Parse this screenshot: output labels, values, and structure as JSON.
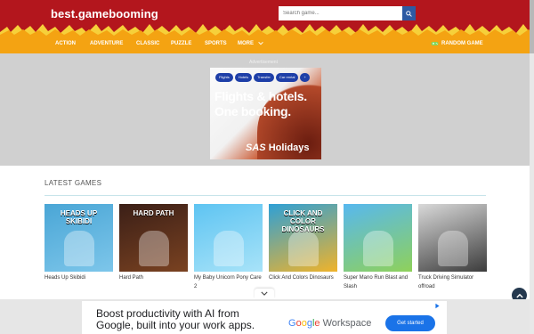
{
  "header": {
    "logo": "best.gamebooming",
    "search_placeholder": "Search game...",
    "search_icon": "magnifier"
  },
  "nav": {
    "items": [
      "ACTION",
      "ADVENTURE",
      "CLASSIC",
      "PUZZLE",
      "SPORTS",
      "MORE"
    ],
    "random": "RANDOM GAME",
    "random_icon": "gamepad"
  },
  "top_ad": {
    "label": "Advertisement",
    "tabs": [
      "Flights",
      "Hotels",
      "Transfer",
      "Car rental",
      "+"
    ],
    "headline": "Flights & hotels. One booking.",
    "brand_mark": "SAS",
    "brand_word": "Holidays"
  },
  "latest": {
    "title": "LATEST GAMES",
    "games": [
      {
        "title": "Heads Up Skibidi",
        "thumb_text": "HEADS UP SKIBIDI",
        "colors": [
          "#4aa6d6",
          "#7dc6ea"
        ]
      },
      {
        "title": "Hard Path",
        "thumb_text": "HARD PATH",
        "colors": [
          "#3b1f17",
          "#7a4221"
        ]
      },
      {
        "title": "My Baby Unicorn Pony Care 2",
        "thumb_text": "",
        "colors": [
          "#5ec4f2",
          "#a8e3f8"
        ]
      },
      {
        "title": "Click And Colors Dinosaurs",
        "thumb_text": "CLICK AND COLOR DINOSAURS",
        "colors": [
          "#2ea0d6",
          "#f0b32a"
        ]
      },
      {
        "title": "Super Mano Run Blast and Slash",
        "thumb_text": "",
        "colors": [
          "#57b8ef",
          "#8fd15a"
        ]
      },
      {
        "title": "Truck Driving Simulator offroad",
        "thumb_text": "",
        "colors": [
          "#d9d9d9",
          "#3c3c3c"
        ]
      }
    ]
  },
  "bottom_ad": {
    "headline": "Boost productivity with AI from Google, built into your work apps.",
    "brand": "Google Workspace",
    "brand_letters": [
      "G",
      "o",
      "o",
      "g",
      "l",
      "e"
    ],
    "brand_suffix": " Workspace",
    "cta": "Get started",
    "choices_icon": "ad-choices"
  },
  "colors": {
    "header_red": "#b3161d",
    "nav_orange": "#f4a312",
    "accent_blue": "#2d5aa3",
    "to_top": "#25394f"
  }
}
